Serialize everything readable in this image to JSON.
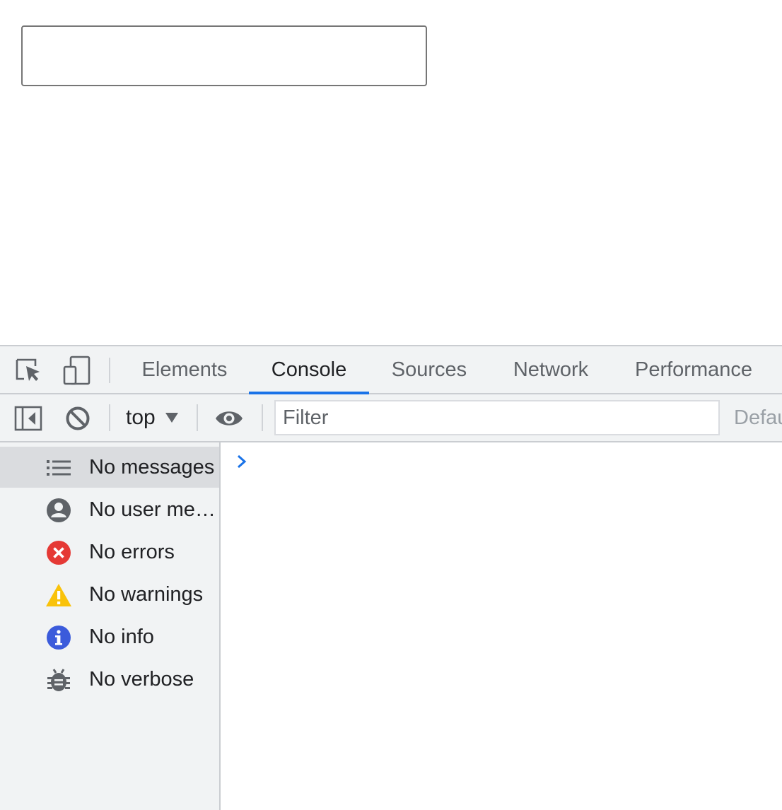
{
  "page": {
    "input_value": ""
  },
  "devtools": {
    "tabs": [
      {
        "label": "Elements",
        "active": false
      },
      {
        "label": "Console",
        "active": true
      },
      {
        "label": "Sources",
        "active": false
      },
      {
        "label": "Network",
        "active": false
      },
      {
        "label": "Performance",
        "active": false
      }
    ],
    "toolbar": {
      "context": "top",
      "filter_placeholder": "Filter",
      "levels_label": "Defau"
    },
    "sidebar": {
      "items": [
        {
          "label": "No messages",
          "icon": "list-icon",
          "selected": true
        },
        {
          "label": "No user messages",
          "icon": "user-icon",
          "selected": false
        },
        {
          "label": "No errors",
          "icon": "error-icon",
          "selected": false
        },
        {
          "label": "No warnings",
          "icon": "warning-icon",
          "selected": false
        },
        {
          "label": "No info",
          "icon": "info-icon",
          "selected": false
        },
        {
          "label": "No verbose",
          "icon": "bug-icon",
          "selected": false
        }
      ]
    },
    "colors": {
      "accent": "#1a73e8",
      "error": "#e53935",
      "warning": "#f9c20a",
      "info": "#3b5bdb",
      "prompt": "#1a73e8"
    }
  }
}
